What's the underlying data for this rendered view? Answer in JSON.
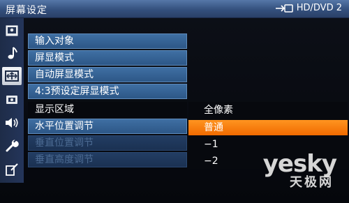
{
  "header": {
    "title": "屏幕设定",
    "source_label": "HD/DVD 2",
    "source_icon": "input-arrow-icon"
  },
  "sidebar": {
    "icons": [
      {
        "name": "picture-icon",
        "selected": false
      },
      {
        "name": "music-note-icon",
        "selected": false
      },
      {
        "name": "screen-icon",
        "selected": true
      },
      {
        "name": "setup-icon",
        "selected": false
      },
      {
        "name": "speaker-icon",
        "selected": false
      },
      {
        "name": "wrench-icon",
        "selected": false
      },
      {
        "name": "edit-icon",
        "selected": false
      }
    ]
  },
  "menu": {
    "items": [
      {
        "label": "输入对象",
        "state": "normal"
      },
      {
        "label": "屏显模式",
        "state": "normal"
      },
      {
        "label": "自动屏显模式",
        "state": "normal"
      },
      {
        "label": "4:3预设定屏显模式",
        "state": "normal"
      },
      {
        "label": "显示区域",
        "state": "active"
      },
      {
        "label": "水平位置调节",
        "state": "normal"
      },
      {
        "label": "垂直位置调节",
        "state": "disabled"
      },
      {
        "label": "垂直高度调节",
        "state": "disabled"
      }
    ]
  },
  "submenu": {
    "options": [
      {
        "label": "全像素",
        "selected": false
      },
      {
        "label": "普通",
        "selected": true
      },
      {
        "label": "−1",
        "selected": false
      },
      {
        "label": "−2",
        "selected": false
      }
    ]
  },
  "watermark": {
    "brand": "yesky",
    "sub": "天极网"
  },
  "colors": {
    "accent": "#f47a00",
    "menu_blue": "#3f6fa3",
    "title_bar": "#34507d"
  }
}
